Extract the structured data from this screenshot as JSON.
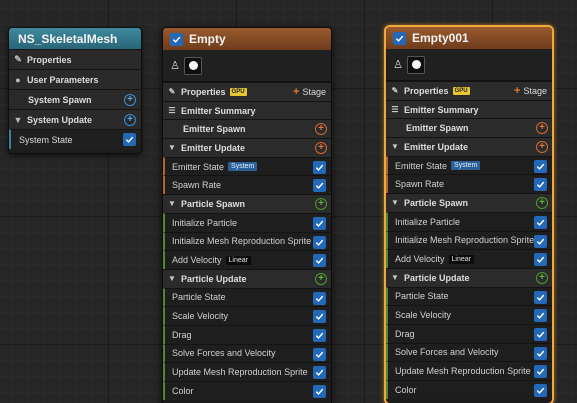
{
  "system": {
    "title": "NS_SkeletalMesh",
    "properties": "Properties",
    "user_parameters": "User Parameters",
    "system_spawn": "System Spawn",
    "system_update": "System Update",
    "system_state": "System State"
  },
  "emitters": [
    {
      "title": "Empty",
      "properties": "Properties",
      "gpu": "GPU",
      "stage": "Stage",
      "emitter_summary": "Emitter Summary",
      "emitter_spawn": "Emitter Spawn",
      "emitter_update": "Emitter Update",
      "emitter_state": "Emitter State",
      "emitter_state_tag": "System",
      "spawn_rate": "Spawn Rate",
      "particle_spawn": "Particle Spawn",
      "initialize_particle": "Initialize Particle",
      "init_mesh_repro": "Initialize Mesh Reproduction Sprite",
      "add_velocity": "Add Velocity",
      "add_velocity_tag": "Linear",
      "particle_update": "Particle Update",
      "particle_state": "Particle State",
      "scale_velocity": "Scale Velocity",
      "drag": "Drag",
      "solve_forces": "Solve Forces and Velocity",
      "update_mesh_repro": "Update Mesh Reproduction Sprite",
      "color": "Color"
    },
    {
      "title": "Empty001",
      "properties": "Properties",
      "gpu": "GPU",
      "stage": "Stage",
      "emitter_summary": "Emitter Summary",
      "emitter_spawn": "Emitter Spawn",
      "emitter_update": "Emitter Update",
      "emitter_state": "Emitter State",
      "emitter_state_tag": "System",
      "spawn_rate": "Spawn Rate",
      "particle_spawn": "Particle Spawn",
      "initialize_particle": "Initialize Particle",
      "init_mesh_repro": "Initialize Mesh Reproduction Sprite",
      "add_velocity": "Add Velocity",
      "add_velocity_tag": "Linear",
      "particle_update": "Particle Update",
      "particle_state": "Particle State",
      "scale_velocity": "Scale Velocity",
      "drag": "Drag",
      "solve_forces": "Solve Forces and Velocity",
      "update_mesh_repro": "Update Mesh Reproduction Sprite",
      "color": "Color"
    }
  ],
  "colors": {
    "canvas": "#262626",
    "system_header": "#3e8a9f",
    "emitter_header": "#9a5a2e",
    "selection": "#f0a83a",
    "checkbox": "#2469b8",
    "gpu_badge": "#e7c832",
    "stage_orange": "#d46a34",
    "stage_green": "#4f9a32",
    "add_blue": "#3d8fd6"
  }
}
